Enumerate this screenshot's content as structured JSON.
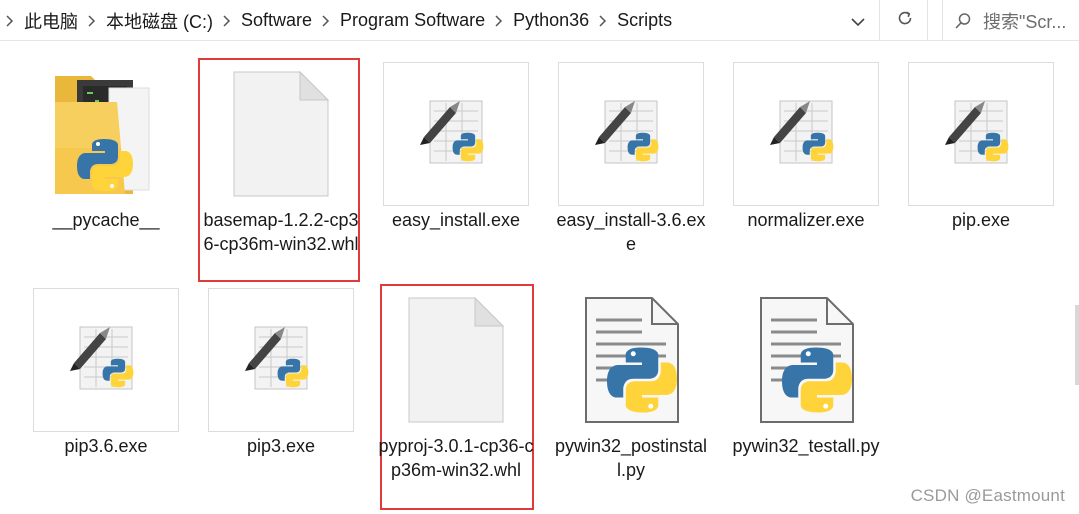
{
  "address_bar": {
    "crumbs": [
      "此电脑",
      "本地磁盘 (C:)",
      "Software",
      "Program Software",
      "Python36",
      "Scripts"
    ]
  },
  "search": {
    "placeholder": "搜索\"Scr..."
  },
  "items": [
    {
      "label": "__pycache__",
      "type": "folder",
      "selected": false
    },
    {
      "label": "basemap-1.2.2-cp36-cp36m-win32.whl",
      "type": "whl",
      "selected": true
    },
    {
      "label": "easy_install.exe",
      "type": "exe",
      "selected": false
    },
    {
      "label": "easy_install-3.6.exe",
      "type": "exe",
      "selected": false
    },
    {
      "label": "normalizer.exe",
      "type": "exe",
      "selected": false
    },
    {
      "label": "pip.exe",
      "type": "exe",
      "selected": false
    },
    {
      "label": "pip3.6.exe",
      "type": "exe",
      "selected": false
    },
    {
      "label": "pip3.exe",
      "type": "exe",
      "selected": false
    },
    {
      "label": "pyproj-3.0.1-cp36-cp36m-win32.whl",
      "type": "whl",
      "selected": true
    },
    {
      "label": "pywin32_postinstall.py",
      "type": "py",
      "selected": false
    },
    {
      "label": "pywin32_testall.py",
      "type": "py",
      "selected": false
    }
  ],
  "watermark": "CSDN @Eastmount",
  "colors": {
    "highlight": "#e03b3b",
    "python_blue": "#3775a9",
    "python_yellow": "#ffd43b",
    "folder": "#f6c94e"
  }
}
